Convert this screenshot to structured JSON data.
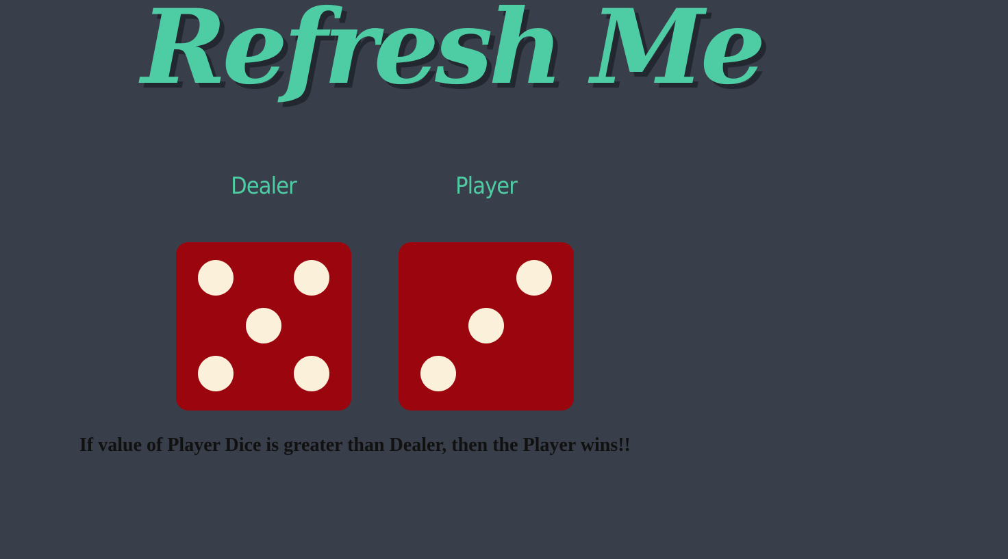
{
  "title": "Refresh Me",
  "players": [
    {
      "label": "Dealer",
      "dice_value": 5
    },
    {
      "label": "Player",
      "dice_value": 3
    }
  ],
  "rule_text": "If value of Player Dice is greater than Dealer, then the Player wins!!",
  "colors": {
    "background": "#393f4a",
    "accent": "#4ecca3",
    "die_face": "#9b050d",
    "pip": "#fbf0d9",
    "text": "#111111"
  }
}
